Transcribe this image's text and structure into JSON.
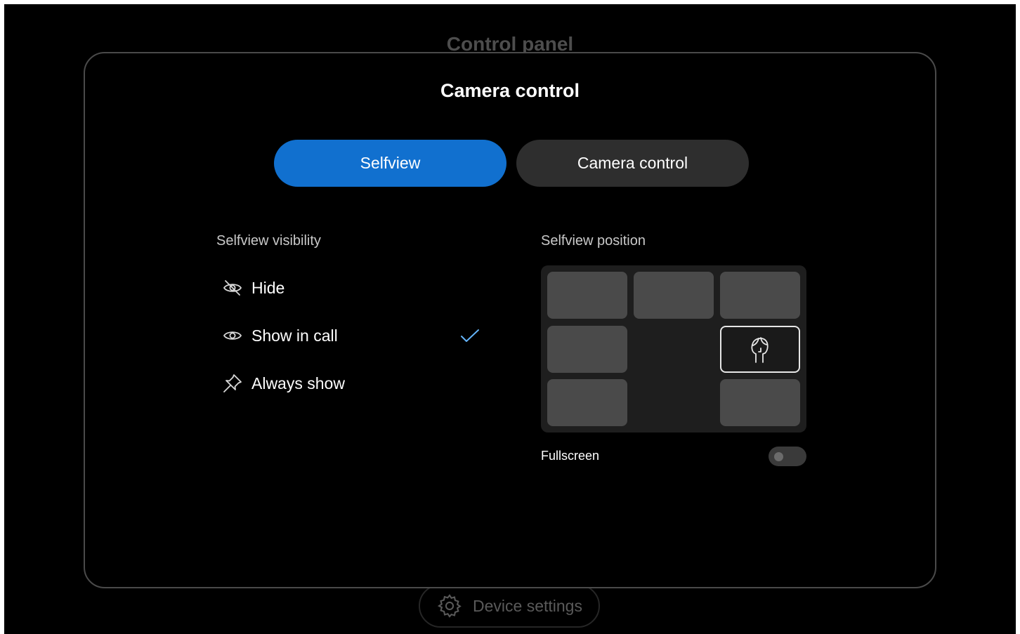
{
  "background": {
    "title": "Control panel",
    "device_settings_label": "Device settings"
  },
  "panel": {
    "title": "Camera control",
    "tabs": [
      {
        "label": "Selfview",
        "selected": true
      },
      {
        "label": "Camera control",
        "selected": false
      }
    ]
  },
  "visibility": {
    "heading": "Selfview visibility",
    "options": [
      {
        "label": "Hide",
        "icon": "eye-slash-icon",
        "selected": false
      },
      {
        "label": "Show in call",
        "icon": "eye-icon",
        "selected": true
      },
      {
        "label": "Always show",
        "icon": "pin-icon",
        "selected": false
      }
    ]
  },
  "position": {
    "heading": "Selfview position",
    "selected_cell": "middle-right",
    "fullscreen_label": "Fullscreen",
    "fullscreen_on": false
  },
  "colors": {
    "accent": "#1170cf",
    "check": "#64b4fa"
  }
}
